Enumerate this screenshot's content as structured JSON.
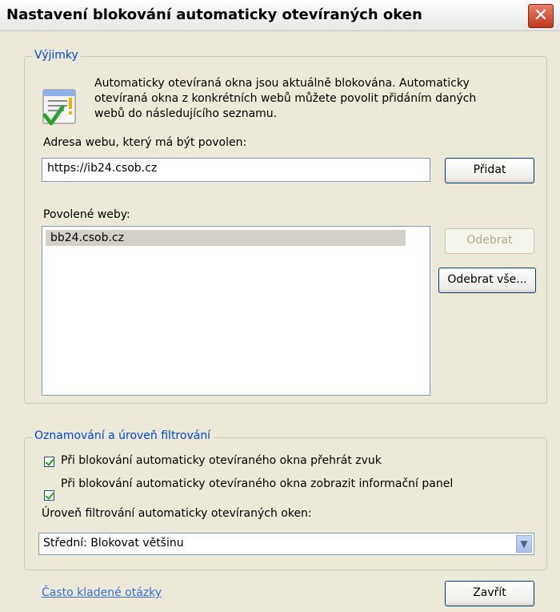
{
  "dialog": {
    "title": "Nastavení blokování automaticky otevíraných oken",
    "close_glyph": "✕"
  },
  "exceptions": {
    "legend": "Výjimky",
    "info_lines": [
      "Automaticky otevíraná okna jsou aktuálně blokována. Automaticky",
      "otevíraná okna z konkrétních webů můžete povolit přidáním daných",
      "webů do následujícího seznamu."
    ],
    "address_label": "Adresa webu, který má být povolen:",
    "address_value": "https://ib24.csob.cz",
    "add_button": "Přidat",
    "allowed_label": "Povolené weby:",
    "allowed_sites": [
      "bb24.csob.cz"
    ],
    "remove_button": "Odebrat",
    "remove_all_button": "Odebrat vše..."
  },
  "notifications": {
    "legend": "Oznamování a úroveň filtrování",
    "checkboxes": [
      {
        "label": "Při blokování automaticky otevíraného okna přehrát zvuk",
        "checked": true
      },
      {
        "label": "Při blokování automaticky otevíraného okna zobrazit informační panel",
        "checked": true
      }
    ],
    "filter_label": "Úroveň filtrování automaticky otevíraných oken:",
    "filter_value": "Střední: Blokovat většinu"
  },
  "footer": {
    "faq_link": "Často kladené otázky",
    "close_button": "Zavřít"
  }
}
